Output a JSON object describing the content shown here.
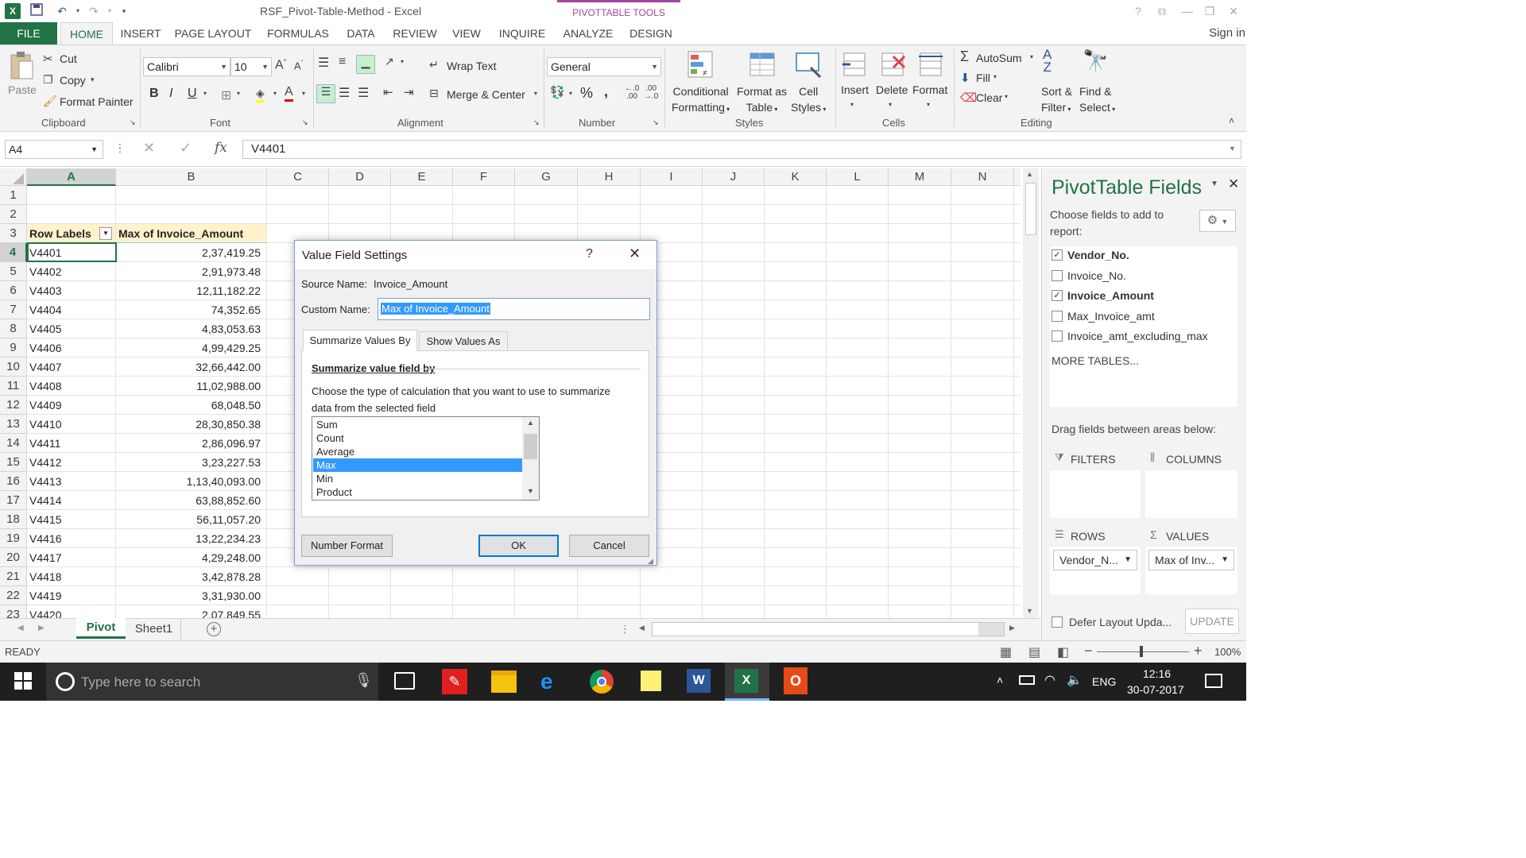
{
  "window": {
    "title": "RSF_Pivot-Table-Method - Excel",
    "context_tab_group": "PIVOTTABLE TOOLS",
    "sign_in": "Sign in"
  },
  "tabs": [
    "FILE",
    "HOME",
    "INSERT",
    "PAGE LAYOUT",
    "FORMULAS",
    "DATA",
    "REVIEW",
    "VIEW",
    "INQUIRE",
    "ANALYZE",
    "DESIGN"
  ],
  "ribbon": {
    "clipboard": {
      "paste": "Paste",
      "cut": "Cut",
      "copy": "Copy",
      "format_painter": "Format Painter",
      "label": "Clipboard"
    },
    "font": {
      "name": "Calibri",
      "size": "10",
      "bold": "B",
      "italic": "I",
      "underline": "U",
      "label": "Font"
    },
    "alignment": {
      "wrap": "Wrap Text",
      "merge": "Merge & Center",
      "label": "Alignment"
    },
    "number": {
      "format": "General",
      "percent": "%",
      "comma": ",",
      "label": "Number"
    },
    "styles": {
      "conditional_1": "Conditional",
      "conditional_2": "Formatting",
      "format_as_1": "Format as",
      "format_as_2": "Table",
      "cell_styles_1": "Cell",
      "cell_styles_2": "Styles",
      "label": "Styles"
    },
    "cells": {
      "insert": "Insert",
      "delete": "Delete",
      "format": "Format",
      "label": "Cells"
    },
    "editing": {
      "autosum": "AutoSum",
      "fill": "Fill",
      "clear": "Clear",
      "sort_1": "Sort &",
      "sort_2": "Filter",
      "find_1": "Find &",
      "find_2": "Select",
      "label": "Editing"
    }
  },
  "formula_bar": {
    "name_box": "A4",
    "fx": "fx",
    "value": "V4401"
  },
  "columns": [
    "A",
    "B",
    "C",
    "D",
    "E",
    "F",
    "G",
    "H",
    "I",
    "J",
    "K",
    "L",
    "M",
    "N"
  ],
  "rows": [
    "1",
    "2",
    "3",
    "4",
    "5",
    "6",
    "7",
    "8",
    "9",
    "10",
    "11",
    "12",
    "13",
    "14",
    "15",
    "16",
    "17",
    "18",
    "19",
    "20",
    "21",
    "22",
    "23"
  ],
  "pivot": {
    "header_a": "Row Labels",
    "header_b": "Max of Invoice_Amount",
    "data": [
      [
        "V4401",
        "2,37,419.25"
      ],
      [
        "V4402",
        "2,91,973.48"
      ],
      [
        "V4403",
        "12,11,182.22"
      ],
      [
        "V4404",
        "74,352.65"
      ],
      [
        "V4405",
        "4,83,053.63"
      ],
      [
        "V4406",
        "4,99,429.25"
      ],
      [
        "V4407",
        "32,66,442.00"
      ],
      [
        "V4408",
        "11,02,988.00"
      ],
      [
        "V4409",
        "68,048.50"
      ],
      [
        "V4410",
        "28,30,850.38"
      ],
      [
        "V4411",
        "2,86,096.97"
      ],
      [
        "V4412",
        "3,23,227.53"
      ],
      [
        "V4413",
        "1,13,40,093.00"
      ],
      [
        "V4414",
        "63,88,852.60"
      ],
      [
        "V4415",
        "56,11,057.20"
      ],
      [
        "V4416",
        "13,22,234.23"
      ],
      [
        "V4417",
        "4,29,248.00"
      ],
      [
        "V4418",
        "3,42,878.28"
      ],
      [
        "V4419",
        "3,31,930.00"
      ],
      [
        "V4420",
        "2,07,849.55"
      ]
    ]
  },
  "sheets": {
    "active": "Pivot",
    "other": "Sheet1"
  },
  "status": {
    "mode": "READY",
    "zoom": "100%"
  },
  "dialog": {
    "title": "Value Field Settings",
    "help": "?",
    "source_label": "Source Name:",
    "source_value": "Invoice_Amount",
    "custom_label": "Custom Name:",
    "custom_value": "Max of Invoice_Amount",
    "tab1": "Summarize Values By",
    "tab2": "Show Values As",
    "section_title": "Summarize value field by",
    "desc_1": "Choose the type of calculation that you want to use to summarize",
    "desc_2": "data from the selected field",
    "options": [
      "Sum",
      "Count",
      "Average",
      "Max",
      "Min",
      "Product"
    ],
    "selected": "Max",
    "number_format": "Number Format",
    "ok": "OK",
    "cancel": "Cancel"
  },
  "pane": {
    "title": "PivotTable Fields",
    "choose_1": "Choose fields to add to",
    "choose_2": "report:",
    "fields": [
      {
        "name": "Vendor_No.",
        "checked": true
      },
      {
        "name": "Invoice_No.",
        "checked": false
      },
      {
        "name": "Invoice_Amount",
        "checked": true
      },
      {
        "name": "Max_Invoice_amt",
        "checked": false
      },
      {
        "name": "Invoice_amt_excluding_max",
        "checked": false
      }
    ],
    "more_tables": "MORE TABLES...",
    "drag_label": "Drag fields between areas below:",
    "filters": "FILTERS",
    "columns": "COLUMNS",
    "rows": "ROWS",
    "values": "VALUES",
    "rows_item": "Vendor_N...",
    "values_item": "Max of Inv...",
    "defer": "Defer Layout Upda...",
    "update": "UPDATE"
  },
  "taskbar": {
    "search_placeholder": "Type here to search",
    "lang": "ENG",
    "time": "12:16",
    "date": "30-07-2017"
  },
  "colors": {
    "excel_green": "#217346",
    "pivot_header_bg": "#fff2cc",
    "selection_blue": "#3399ff",
    "context_purple": "#a0479e"
  }
}
